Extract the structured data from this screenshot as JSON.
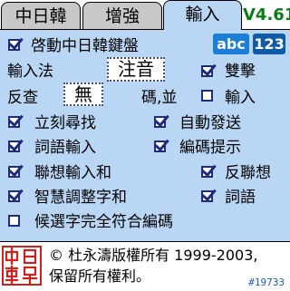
{
  "tabs": [
    {
      "label": "中日韓"
    },
    {
      "label": "增強"
    },
    {
      "label": "輸入"
    }
  ],
  "version": "V4.61",
  "enable_keyboard": {
    "label": "啓動中日韓鍵盤",
    "checked": true
  },
  "input_mode_buttons": {
    "abc": "abc",
    "num": "123"
  },
  "input_method": {
    "label": "輸入法",
    "value": "注音"
  },
  "double_strike": {
    "label": "雙擊",
    "checked": true
  },
  "reverse_lookup": {
    "label": "反查",
    "value": "無",
    "suffix": "碼,並"
  },
  "reverse_input": {
    "label": "輸入",
    "checked": false
  },
  "options": {
    "instant_search": {
      "label": "立刻尋找",
      "checked": true
    },
    "auto_send": {
      "label": "自動發送",
      "checked": true
    },
    "phrase_input": {
      "label": "詞語輸入",
      "checked": true
    },
    "code_hint": {
      "label": "編碼提示",
      "checked": true
    },
    "assoc_input": {
      "label": "聯想輸入和",
      "checked": true
    },
    "reverse_assoc": {
      "label": "反聯想",
      "checked": true
    },
    "smart_adjust": {
      "label": "智慧調整字和",
      "checked": true
    },
    "phrase": {
      "label": "詞語",
      "checked": true
    },
    "full_match": {
      "label": "候選字完全符合編碼",
      "checked": false
    }
  },
  "footer": {
    "copyright_line1": "© 杜永濤版權所有 1999-2003,",
    "copyright_line2": "保留所有權利。",
    "build": "#19733"
  },
  "colors": {
    "panel": "#b9d6f4",
    "accent": "#1f2c7a",
    "version": "#0b7d16"
  }
}
